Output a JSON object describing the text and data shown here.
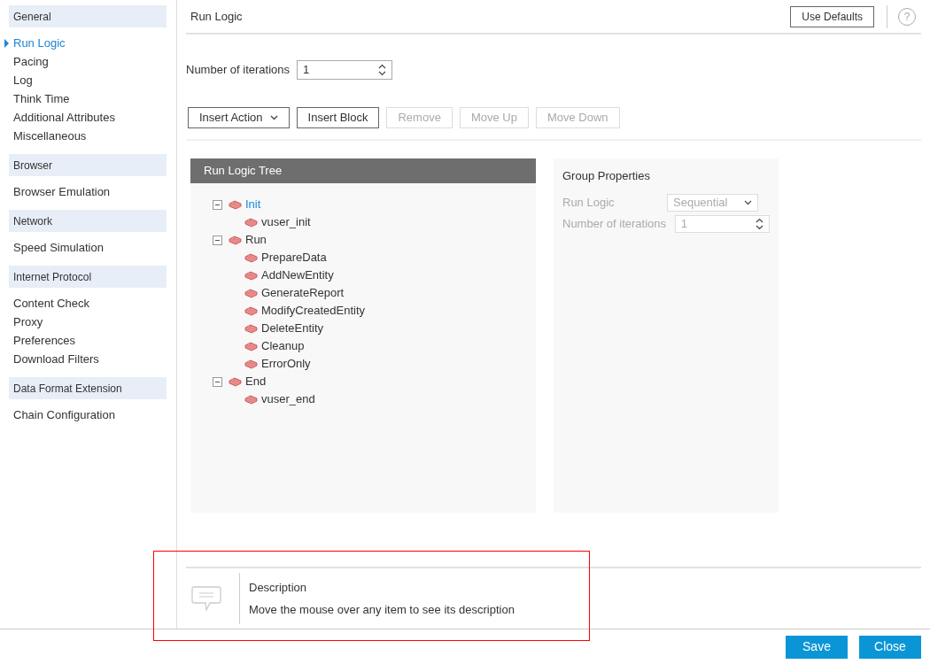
{
  "sidebar": {
    "groups": [
      {
        "title": "General",
        "items": [
          {
            "label": "Run Logic",
            "selected": true
          },
          {
            "label": "Pacing",
            "selected": false
          },
          {
            "label": "Log",
            "selected": false
          },
          {
            "label": "Think Time",
            "selected": false
          },
          {
            "label": "Additional Attributes",
            "selected": false
          },
          {
            "label": "Miscellaneous",
            "selected": false
          }
        ]
      },
      {
        "title": "Browser",
        "items": [
          {
            "label": "Browser Emulation",
            "selected": false
          }
        ]
      },
      {
        "title": "Network",
        "items": [
          {
            "label": "Speed Simulation",
            "selected": false
          }
        ]
      },
      {
        "title": "Internet Protocol",
        "items": [
          {
            "label": "Content Check",
            "selected": false
          },
          {
            "label": "Proxy",
            "selected": false
          },
          {
            "label": "Preferences",
            "selected": false
          },
          {
            "label": "Download Filters",
            "selected": false
          }
        ]
      },
      {
        "title": "Data Format Extension",
        "items": [
          {
            "label": "Chain Configuration",
            "selected": false
          }
        ]
      }
    ]
  },
  "header": {
    "title": "Run Logic",
    "use_defaults": "Use Defaults",
    "help": "?"
  },
  "iterations": {
    "label": "Number of iterations",
    "value": "1"
  },
  "toolbar": [
    {
      "label": "Insert Action",
      "kind": "dropdown",
      "disabled": false
    },
    {
      "label": "Insert Block",
      "kind": "button",
      "disabled": false
    },
    {
      "label": "Remove",
      "kind": "button",
      "disabled": true
    },
    {
      "label": "Move Up",
      "kind": "button",
      "disabled": true
    },
    {
      "label": "Move Down",
      "kind": "button",
      "disabled": true
    }
  ],
  "tree": {
    "title": "Run Logic Tree",
    "nodes": [
      {
        "label": "Init",
        "selected": true,
        "expanded": true,
        "children": [
          {
            "label": "vuser_init",
            "selected": false
          }
        ]
      },
      {
        "label": "Run",
        "selected": false,
        "expanded": true,
        "children": [
          {
            "label": "PrepareData",
            "selected": false
          },
          {
            "label": "AddNewEntity",
            "selected": false
          },
          {
            "label": "GenerateReport",
            "selected": false
          },
          {
            "label": "ModifyCreatedEntity",
            "selected": false
          },
          {
            "label": "DeleteEntity",
            "selected": false
          },
          {
            "label": "Cleanup",
            "selected": false
          },
          {
            "label": "ErrorOnly",
            "selected": false
          }
        ]
      },
      {
        "label": "End",
        "selected": false,
        "expanded": true,
        "children": [
          {
            "label": "vuser_end",
            "selected": false
          }
        ]
      }
    ]
  },
  "group_properties": {
    "title": "Group Properties",
    "disabled": true,
    "run_logic": {
      "label": "Run Logic",
      "value": "Sequential"
    },
    "iterations": {
      "label": "Number of iterations",
      "value": "1"
    }
  },
  "description": {
    "title": "Description",
    "text": "Move the mouse over any item to see its description"
  },
  "footer": {
    "buttons": [
      "Save",
      "Close"
    ]
  }
}
